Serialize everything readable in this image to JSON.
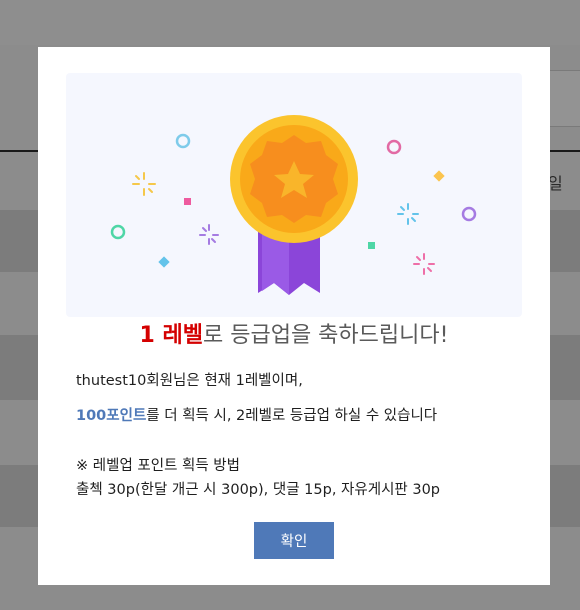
{
  "background_page": {
    "partial_char": "일"
  },
  "modal": {
    "level_text": "1 레벨",
    "headline_rest": "로 등급업을 축하드립니다!",
    "status_line": "thutest10회원님은 현재 1레벨이며,",
    "points_highlight": "100포인트",
    "points_rest": "를 더 획득 시, 2레벨로 등급업 하실 수 있습니다",
    "method_title": "※ 레벨업 포인트 획득 방법",
    "method_detail": "출첵 30p(한달 개근 시 300p), 댓글 15p, 자유게시판 30p",
    "confirm_label": "확인",
    "icons": [
      "medal-icon",
      "star-icon",
      "confetti-icon"
    ]
  },
  "colors": {
    "level": "#d40000",
    "points": "#4f79b8",
    "button": "#4f79b8",
    "medal_gold": "#fbc42d",
    "ribbon": "#8b45d9"
  }
}
